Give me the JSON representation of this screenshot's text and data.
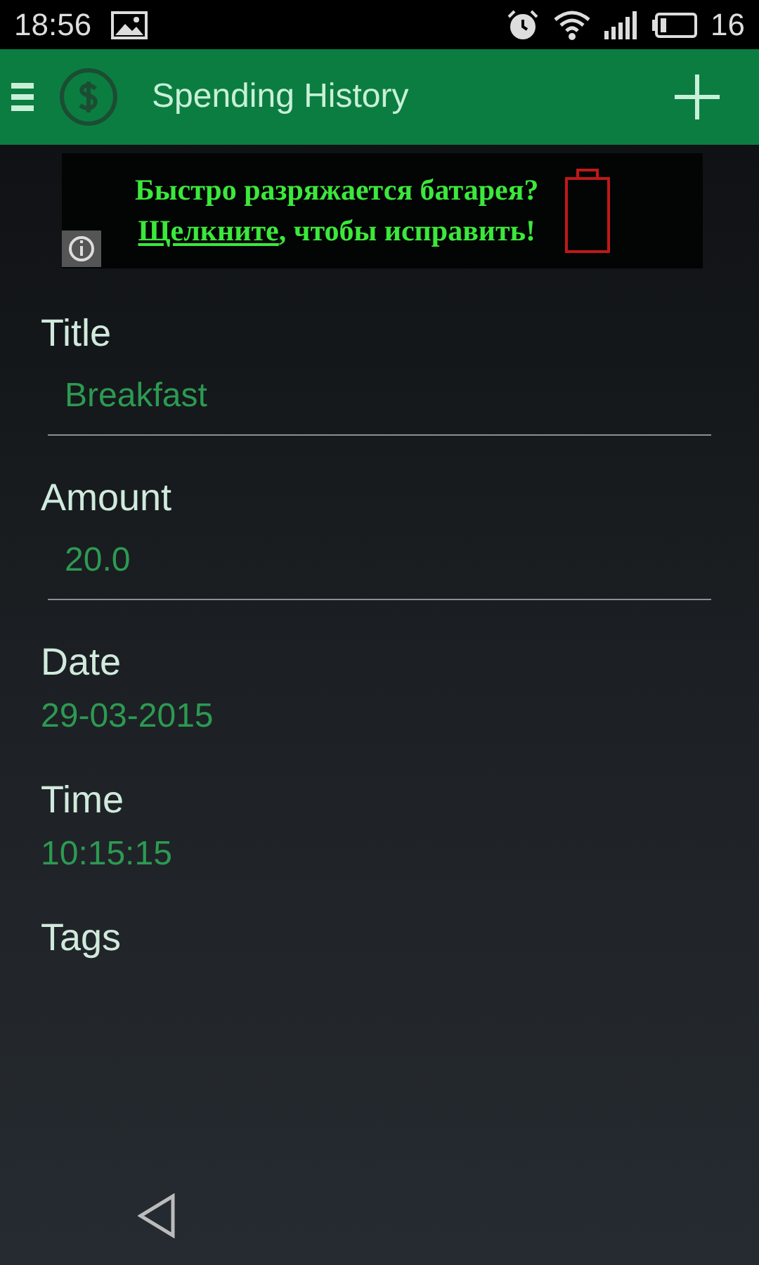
{
  "status_bar": {
    "time": "18:56",
    "battery": "16"
  },
  "app_bar": {
    "title": "Spending History"
  },
  "ad": {
    "headline": "Быстро разряжается батарея?",
    "link": "Щелкните",
    "rest": ", чтобы исправить!"
  },
  "fields": [
    {
      "kind": "input",
      "label": "Title",
      "value": "Breakfast"
    },
    {
      "kind": "input",
      "label": "Amount",
      "value": "20.0"
    },
    {
      "kind": "text",
      "label": "Date",
      "value": "29-03-2015"
    },
    {
      "kind": "text",
      "label": "Time",
      "value": "10:15:15"
    },
    {
      "kind": "cut",
      "label": "Tags"
    }
  ]
}
